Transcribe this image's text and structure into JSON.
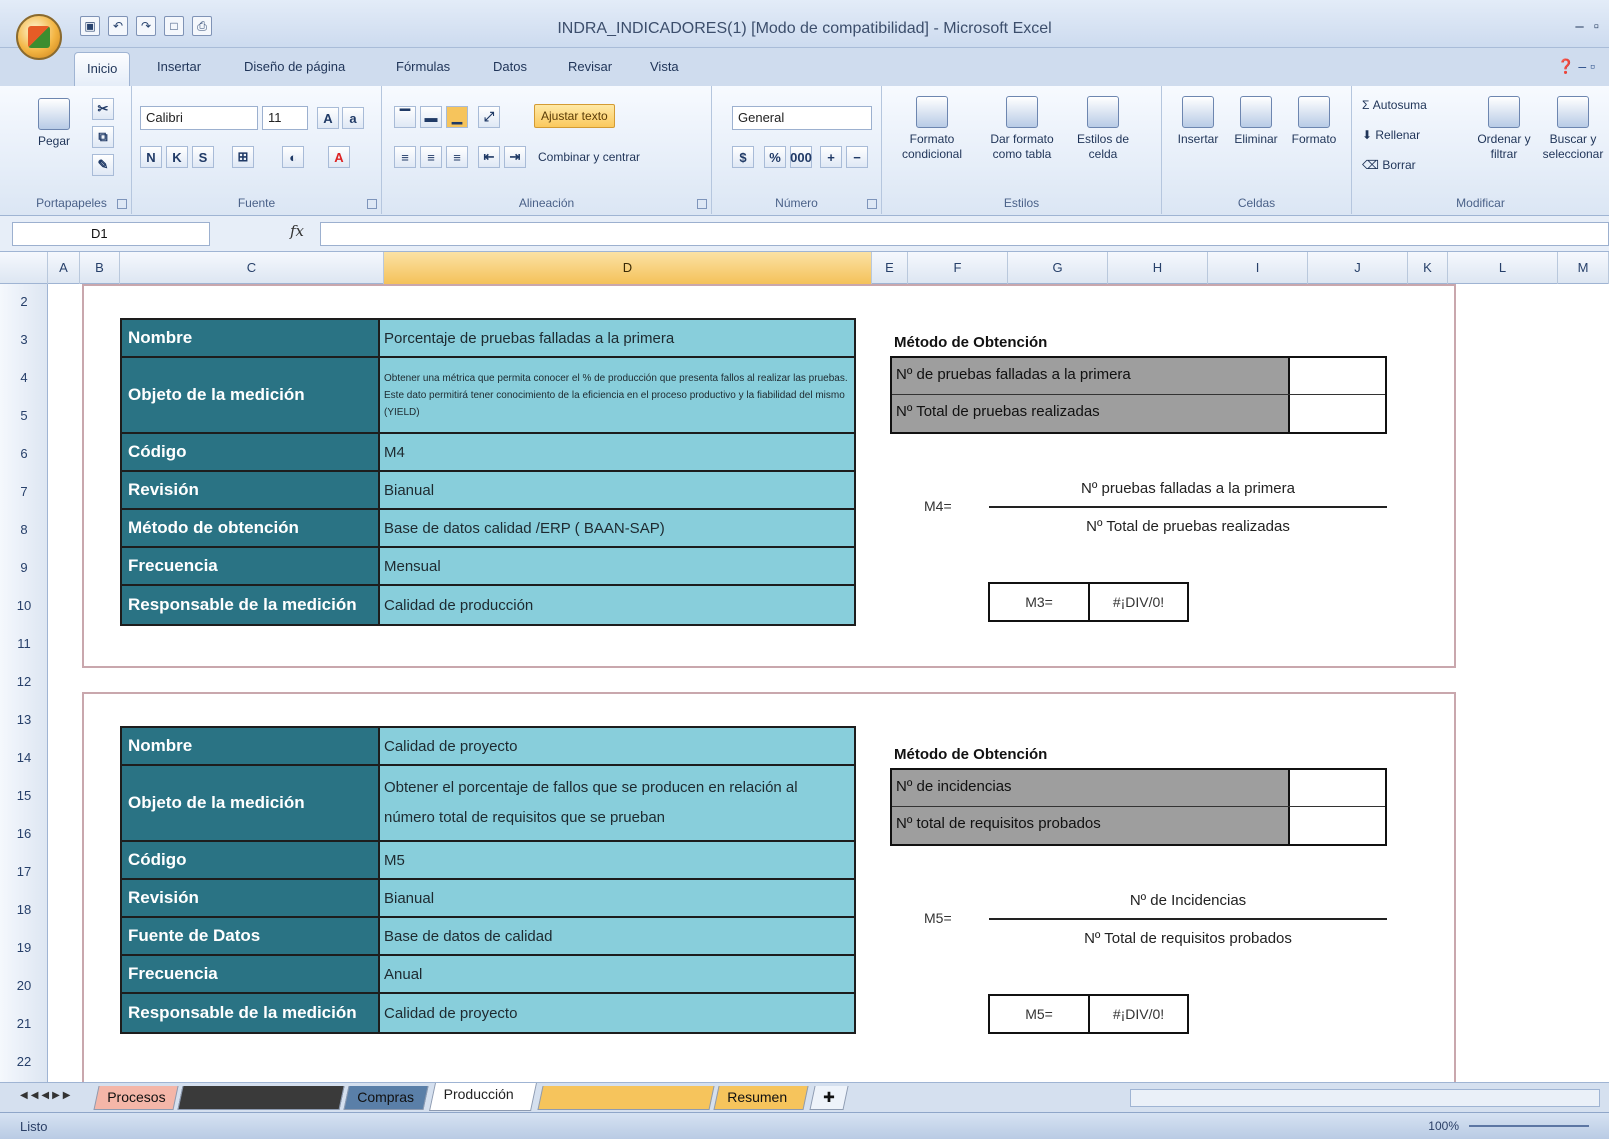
{
  "window": {
    "title": "INDRA_INDICADORES(1) [Modo de compatibilidad] - Microsoft Excel"
  },
  "ribbon": {
    "tabs": [
      "Inicio",
      "Insertar",
      "Diseño de página",
      "Fórmulas",
      "Datos",
      "Revisar",
      "Vista"
    ],
    "groups": {
      "clipboard": {
        "label": "Portapapeles",
        "paste": "Pegar"
      },
      "font": {
        "label": "Fuente",
        "name": "Calibri",
        "size": "11"
      },
      "alignment": {
        "label": "Alineación",
        "wrap": "Ajustar texto",
        "merge": "Combinar y centrar"
      },
      "number": {
        "label": "Número",
        "format": "General"
      },
      "styles": {
        "label": "Estilos",
        "cond": "Formato condicional",
        "table": "Dar formato como tabla",
        "cell": "Estilos de celda"
      },
      "cells": {
        "label": "Celdas",
        "insert": "Insertar",
        "delete": "Eliminar",
        "format": "Formato"
      },
      "editing": {
        "label": "Modificar",
        "autosum": "Autosuma",
        "fill": "Rellenar",
        "clear": "Borrar",
        "sort": "Ordenar y filtrar",
        "find": "Buscar y seleccionar"
      }
    }
  },
  "formula_bar": {
    "cell": "D1",
    "fx": "fx",
    "value": ""
  },
  "columns": [
    "A",
    "B",
    "C",
    "D",
    "E",
    "F",
    "G",
    "H",
    "I",
    "J",
    "K",
    "L",
    "M"
  ],
  "rows": [
    "2",
    "3",
    "4",
    "5",
    "6",
    "7",
    "8",
    "9",
    "10",
    "11",
    "12",
    "13",
    "14",
    "15",
    "16",
    "17",
    "18",
    "19",
    "20",
    "21",
    "22"
  ],
  "sheet": {
    "panel1": {
      "info": [
        {
          "label": "Nombre",
          "value": "Porcentaje de pruebas falladas a la primera"
        },
        {
          "label": "Objeto de la medición",
          "value": "Obtener una métrica que permita conocer el % de producción que presenta fallos al realizar las pruebas. Este dato permitirá tener conocimiento de la eficiencia en el proceso productivo y la fiabilidad del mismo (YIELD)"
        },
        {
          "label": "Código",
          "value": "M4"
        },
        {
          "label": "Revisión",
          "value": "Bianual"
        },
        {
          "label": "Método de obtención",
          "value": "Base de datos calidad /ERP ( BAAN-SAP)"
        },
        {
          "label": "Frecuencia",
          "value": "Mensual"
        },
        {
          "label": "Responsable de la medición",
          "value": "Calidad de  producción"
        }
      ],
      "method_title": "Método de Obtención",
      "method_rows": [
        "Nº de pruebas falladas a la primera",
        "Nº Total  de pruebas realizadas"
      ],
      "formula_label": "M4=",
      "numerator": "Nº pruebas falladas a la primera",
      "denominator": "Nº Total de pruebas realizadas",
      "result_label": "M3=",
      "result_value": "#¡DIV/0!"
    },
    "panel2": {
      "info": [
        {
          "label": "Nombre",
          "value": "Calidad de proyecto"
        },
        {
          "label": "Objeto de la medición",
          "value": "Obtener el porcentaje de fallos que se producen en relación al número total de requisitos que se prueban"
        },
        {
          "label": "Código",
          "value": "M5"
        },
        {
          "label": "Revisión",
          "value": "Bianual"
        },
        {
          "label": "Fuente de Datos",
          "value": "Base de datos de calidad"
        },
        {
          "label": "Frecuencia",
          "value": "Anual"
        },
        {
          "label": "Responsable de la medición",
          "value": "Calidad de proyecto"
        }
      ],
      "method_title": "Método de Obtención",
      "method_rows": [
        "Nº de incidencias",
        "Nº total de requisitos probados"
      ],
      "formula_label": "M5=",
      "numerator": "Nº de Incidencias",
      "denominator": "Nº Total de requisitos probados",
      "result_label": "M5=",
      "result_value": "#¡DIV/0!"
    }
  },
  "sheet_tabs": [
    {
      "label": "Procesos",
      "color": "#f4b6a8"
    },
    {
      "label": "",
      "color": "#3a3a3a"
    },
    {
      "label": "Compras",
      "color": "#5a7fa8"
    },
    {
      "label": "Producción",
      "color": "#ffffff"
    },
    {
      "label": "",
      "color": "#f6c45c"
    },
    {
      "label": "Resumen",
      "color": "#f6c45c"
    }
  ],
  "status": {
    "text": "Listo",
    "zoom": "100%"
  },
  "colors": {
    "label_bg": "#2a7384",
    "value_bg": "#88cedb",
    "method_bg": "#9e9e9e"
  }
}
